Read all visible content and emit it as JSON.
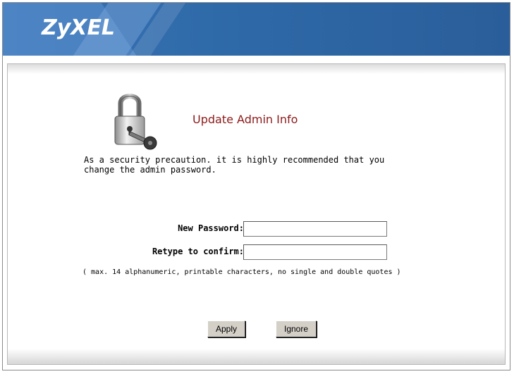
{
  "header": {
    "logo_text": "ZyXEL",
    "colors": {
      "header_bg": "#2f6aa9",
      "title_color": "#8b1a1a"
    }
  },
  "main": {
    "icon": "lock-key-icon",
    "title": "Update Admin Info",
    "message_line1": "As a security precaution. it is highly recommended that you",
    "message_line2": "change the admin password.",
    "fields": [
      {
        "label": "New Password:",
        "value": ""
      },
      {
        "label": "Retype to confirm:",
        "value": ""
      }
    ],
    "hint": "( max. 14 alphanumeric, printable characters, no single and double quotes )",
    "buttons": {
      "apply": "Apply",
      "ignore": "Ignore"
    }
  }
}
